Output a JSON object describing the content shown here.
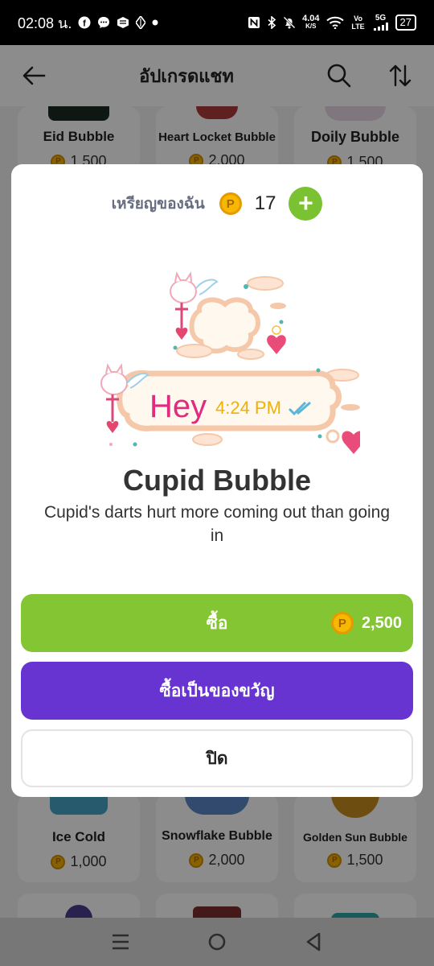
{
  "status_bar": {
    "time": "02:08 น.",
    "net_speed_value": "4.04",
    "net_speed_unit": "K/S",
    "vo_lte": "Vo LTE",
    "network": "5G",
    "battery": "27",
    "icons": [
      "facebook-icon",
      "messenger-icon",
      "app-icon",
      "vpn-icon",
      "dot-icon",
      "nfc-icon",
      "bluetooth-icon",
      "mute-icon",
      "wifi-icon",
      "signal-icon"
    ]
  },
  "header": {
    "title": "อัปเกรดแชท",
    "back_icon": "arrow-left-icon",
    "search_icon": "search-icon",
    "sort_icon": "sort-icon"
  },
  "background_items": {
    "top_row": [
      {
        "name": "Eid Bubble",
        "price": "1,500"
      },
      {
        "name": "Heart Locket Bubble",
        "price": "2,000"
      },
      {
        "name": "Doily Bubble",
        "price": "1,500"
      }
    ],
    "bottom_row": [
      {
        "name": "Ice Cold",
        "price": "1,000"
      },
      {
        "name": "Snowflake Bubble",
        "price": "2,000"
      },
      {
        "name": "Golden Sun Bubble",
        "price": "1,500"
      }
    ]
  },
  "modal": {
    "balance_label": "เหรียญของฉัน",
    "balance_value": "17",
    "coin_letter": "P",
    "add_label": "+",
    "preview": {
      "message_text": "Hey",
      "message_time": "4:24 PM"
    },
    "item_title": "Cupid Bubble",
    "item_description": "Cupid's darts hurt more coming out than going in",
    "buy_label": "ซื้อ",
    "buy_price": "2,500",
    "gift_label": "ซื้อเป็นของขวัญ",
    "close_label": "ปิด"
  },
  "colors": {
    "buy_button": "#83c533",
    "gift_button": "#6734d1",
    "add_button": "#7ac232",
    "coin": "#f6b800",
    "preview_text": "#e02b7e"
  },
  "navbar": {
    "icons": [
      "menu-icon",
      "home-icon",
      "back-icon"
    ]
  }
}
